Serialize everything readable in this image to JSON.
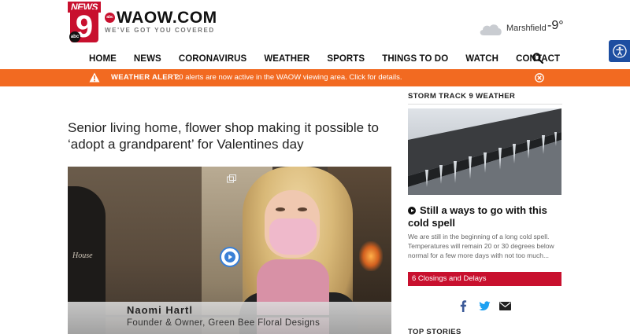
{
  "brand": {
    "logo_news": "NEWS",
    "logo_number": "9",
    "logo_network": "abc",
    "site_name": "WAOW.COM",
    "tagline": "WE'VE GOT YOU COVERED"
  },
  "weather_widget": {
    "icon": "cloud-icon",
    "city": "Marshfield",
    "temperature": "-9°"
  },
  "nav": {
    "items": [
      {
        "label": "HOME"
      },
      {
        "label": "NEWS"
      },
      {
        "label": "CORONAVIRUS"
      },
      {
        "label": "WEATHER"
      },
      {
        "label": "SPORTS"
      },
      {
        "label": "THINGS TO DO"
      },
      {
        "label": "WATCH"
      },
      {
        "label": "CONTACT"
      }
    ],
    "search_icon": "search-icon"
  },
  "alert": {
    "label": "WEATHER ALERT:",
    "text": "20 alerts are now active in the WAOW viewing area. Click for details.",
    "color": "#f26a21"
  },
  "article": {
    "headline": "Senior living home, flower shop making it possible to ‘adopt a grandparent’ for Valentines day",
    "video": {
      "emblem_text": "House",
      "lower_third_name": "Naomi Hartl",
      "lower_third_title": "Founder & Owner, Green Bee Floral Designs"
    }
  },
  "sidebar": {
    "heading": "STORM TRACK 9 WEATHER",
    "story_title": "Still a ways to go with this cold spell",
    "story_desc": "We are still in the beginning of a long cold spell. Temperatures will remain 20 or 30 degrees below normal for a few more days with not too much...",
    "closings_label": "6 Closings and Delays",
    "top_stories_heading": "TOP STORIES"
  },
  "colors": {
    "brand_red": "#c8102e",
    "accessibility_blue": "#1d4ea1",
    "alert_orange": "#f26a21"
  }
}
